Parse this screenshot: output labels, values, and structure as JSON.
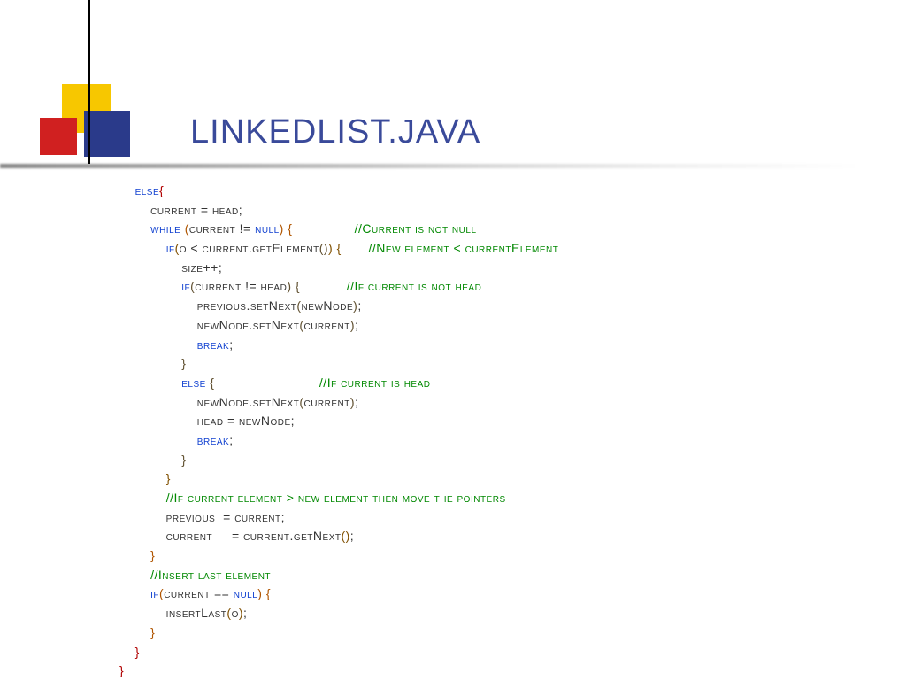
{
  "title": "LINKEDLIST.JAVA",
  "code": {
    "lines": [
      {
        "indent": 0,
        "tokens": [
          {
            "cls": "kw",
            "t": "else"
          },
          {
            "cls": "br1",
            "t": "{"
          }
        ]
      },
      {
        "indent": 1,
        "tokens": [
          {
            "t": "current = head;"
          }
        ]
      },
      {
        "indent": 1,
        "tokens": [
          {
            "cls": "kw",
            "t": "while "
          },
          {
            "cls": "br2",
            "t": "("
          },
          {
            "t": "current != "
          },
          {
            "cls": "kw",
            "t": "null"
          },
          {
            "cls": "br2",
            "t": ")"
          },
          {
            "t": " "
          },
          {
            "cls": "br2",
            "t": "{"
          }
        ],
        "comment": "//Current is not null"
      },
      {
        "indent": 2,
        "tokens": [
          {
            "cls": "kw",
            "t": "if"
          },
          {
            "cls": "br3",
            "t": "("
          },
          {
            "t": "o < current.getElement"
          },
          {
            "cls": "br4",
            "t": "()"
          },
          {
            "cls": "br3",
            "t": ")"
          },
          {
            "t": " "
          },
          {
            "cls": "br3",
            "t": "{"
          }
        ],
        "comment": "//New element < currentElement"
      },
      {
        "indent": 3,
        "tokens": [
          {
            "t": "size++;"
          }
        ]
      },
      {
        "indent": 3,
        "tokens": [
          {
            "cls": "kw",
            "t": "if"
          },
          {
            "cls": "br4",
            "t": "("
          },
          {
            "t": "current != head"
          },
          {
            "cls": "br4",
            "t": ")"
          },
          {
            "t": " "
          },
          {
            "cls": "br4",
            "t": "{"
          }
        ],
        "comment": "//If current is not head"
      },
      {
        "indent": 4,
        "tokens": [
          {
            "t": "previous.setNext"
          },
          {
            "cls": "br4",
            "t": "("
          },
          {
            "t": "newNode"
          },
          {
            "cls": "br4",
            "t": ")"
          },
          {
            "t": ";"
          }
        ]
      },
      {
        "indent": 4,
        "tokens": [
          {
            "t": "newNode.setNext"
          },
          {
            "cls": "br4",
            "t": "("
          },
          {
            "t": "current"
          },
          {
            "cls": "br4",
            "t": ")"
          },
          {
            "t": ";"
          }
        ]
      },
      {
        "indent": 4,
        "tokens": [
          {
            "cls": "kw",
            "t": "break"
          },
          {
            "t": ";"
          }
        ]
      },
      {
        "indent": 3,
        "tokens": [
          {
            "cls": "br4",
            "t": "}"
          }
        ]
      },
      {
        "indent": 3,
        "tokens": [
          {
            "cls": "kw",
            "t": "else"
          },
          {
            "t": " "
          },
          {
            "cls": "br4",
            "t": "{"
          }
        ],
        "comment": "//If current is head"
      },
      {
        "indent": 4,
        "tokens": [
          {
            "t": "newNode.setNext"
          },
          {
            "cls": "br4",
            "t": "("
          },
          {
            "t": "current"
          },
          {
            "cls": "br4",
            "t": ")"
          },
          {
            "t": ";"
          }
        ]
      },
      {
        "indent": 4,
        "tokens": [
          {
            "t": "head = newNode;"
          }
        ]
      },
      {
        "indent": 4,
        "tokens": [
          {
            "cls": "kw",
            "t": "break"
          },
          {
            "t": ";"
          }
        ]
      },
      {
        "indent": 3,
        "tokens": [
          {
            "cls": "br4",
            "t": "}"
          }
        ]
      },
      {
        "indent": 2,
        "tokens": [
          {
            "cls": "br3",
            "t": "}"
          }
        ]
      },
      {
        "indent": 2,
        "tokens": [
          {
            "cls": "com",
            "t": "//If current element > new element then move the pointers"
          }
        ]
      },
      {
        "indent": 2,
        "tokens": [
          {
            "t": "previous  = current;"
          }
        ]
      },
      {
        "indent": 2,
        "tokens": [
          {
            "t": "current     = current.getNext"
          },
          {
            "cls": "br3",
            "t": "()"
          },
          {
            "t": ";"
          }
        ]
      },
      {
        "indent": 1,
        "tokens": [
          {
            "cls": "br2",
            "t": "}"
          }
        ]
      },
      {
        "indent": 1,
        "tokens": [
          {
            "cls": "com",
            "t": "//Insert last element"
          }
        ]
      },
      {
        "indent": 1,
        "tokens": [
          {
            "cls": "kw",
            "t": "if"
          },
          {
            "cls": "br2",
            "t": "("
          },
          {
            "t": "current == "
          },
          {
            "cls": "kw",
            "t": "null"
          },
          {
            "cls": "br2",
            "t": ")"
          },
          {
            "t": " "
          },
          {
            "cls": "br2",
            "t": "{"
          }
        ]
      },
      {
        "indent": 2,
        "tokens": [
          {
            "t": "insertLast"
          },
          {
            "cls": "br3",
            "t": "("
          },
          {
            "t": "o"
          },
          {
            "cls": "br3",
            "t": ")"
          },
          {
            "t": ";"
          }
        ]
      },
      {
        "indent": 1,
        "tokens": [
          {
            "cls": "br2",
            "t": "}"
          }
        ]
      },
      {
        "indent": 0,
        "tokens": [
          {
            "cls": "br1",
            "t": "}"
          }
        ]
      },
      {
        "indent": -1,
        "tokens": [
          {
            "cls": "br1",
            "t": "}"
          }
        ]
      }
    ],
    "commentColumn": 49,
    "indentUnit": 4,
    "baseIndent": 1
  }
}
